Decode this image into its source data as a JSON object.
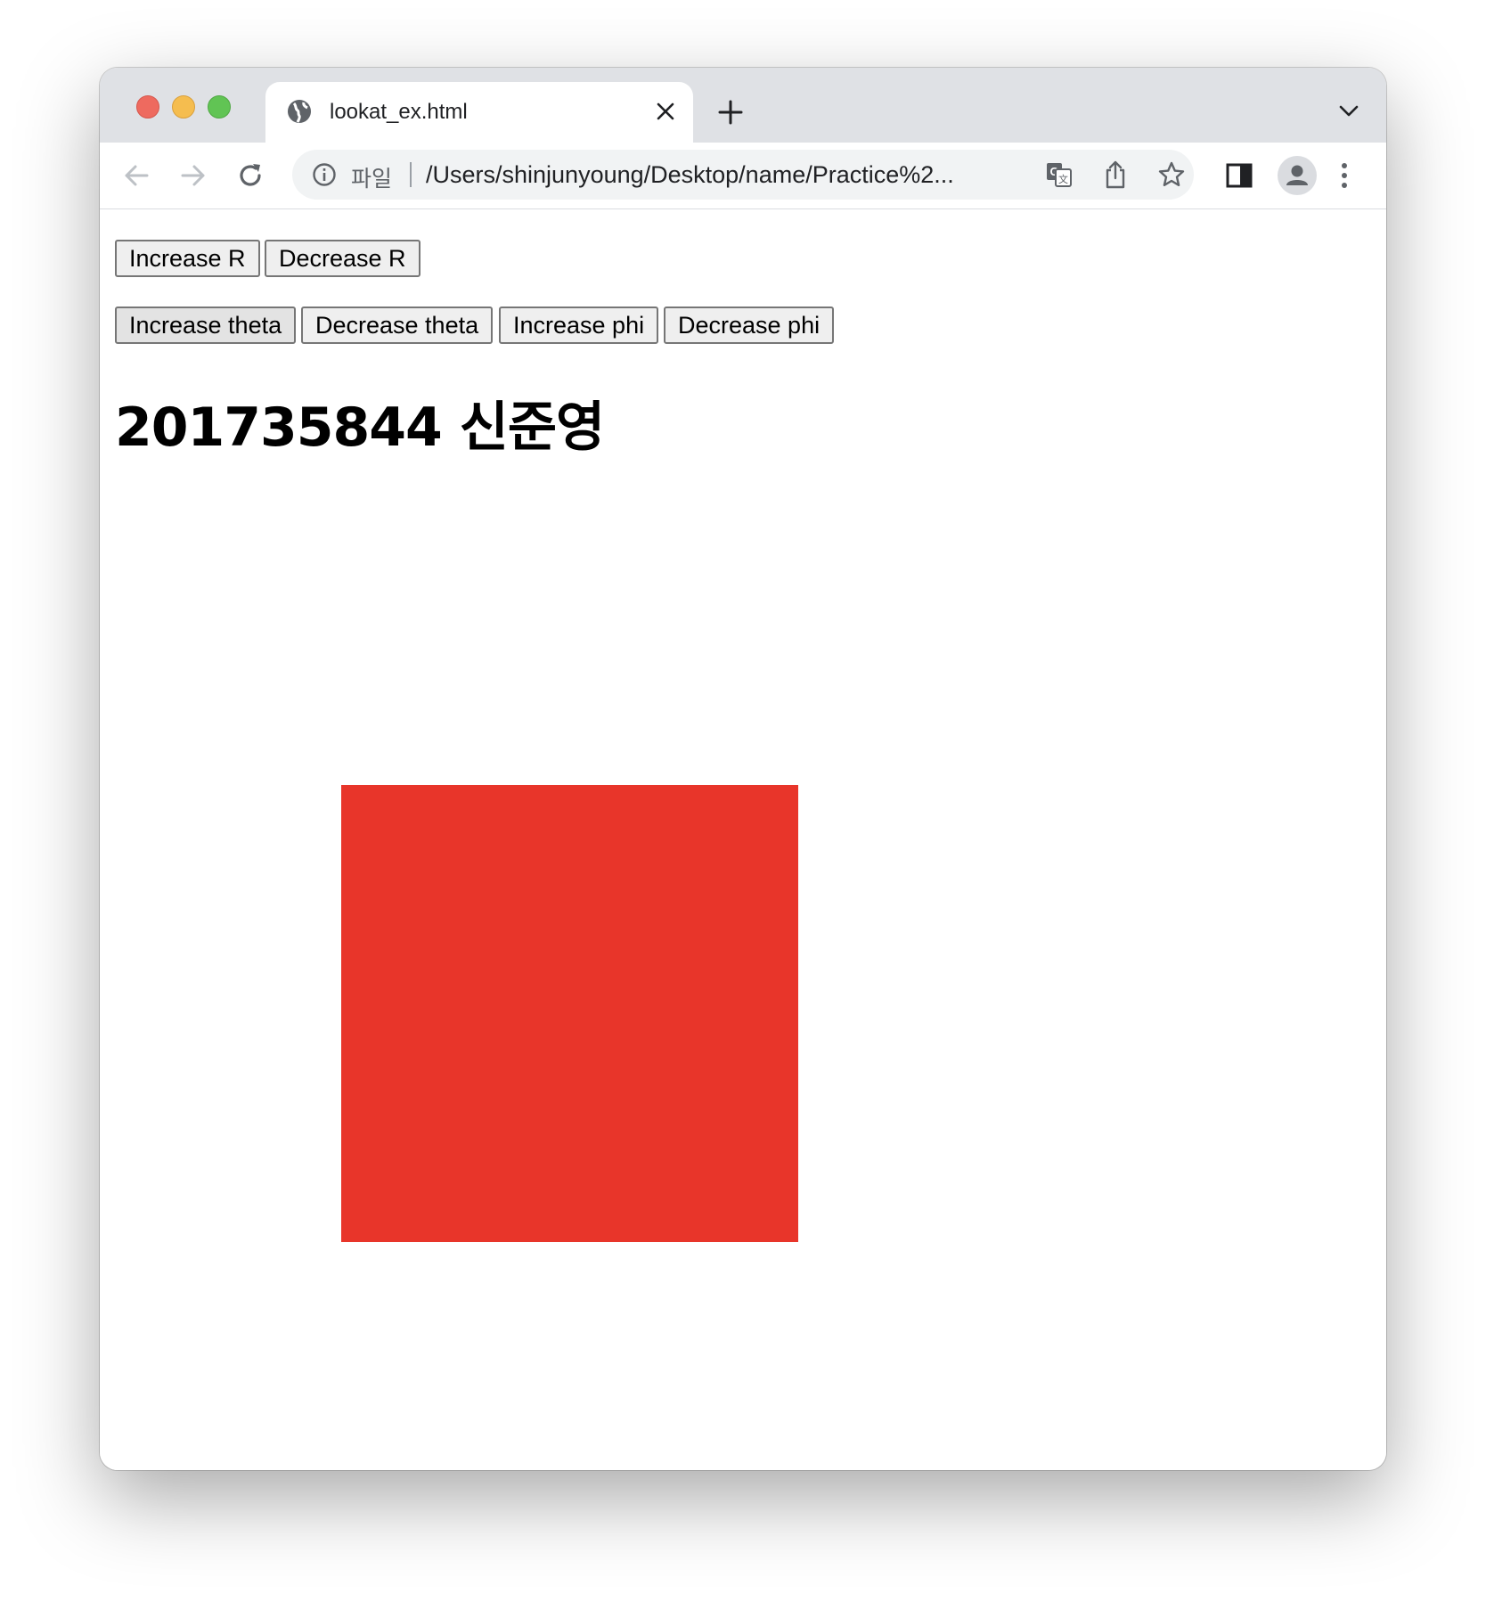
{
  "browser": {
    "tab": {
      "title": "lookat_ex.html"
    },
    "omnibox": {
      "scheme_label": "파일",
      "url": "/Users/shinjunyoung/Desktop/name/Practice%2..."
    }
  },
  "page": {
    "buttons_row1": [
      {
        "label": "Increase R"
      },
      {
        "label": "Decrease R"
      }
    ],
    "buttons_row2": [
      {
        "label": "Increase theta"
      },
      {
        "label": "Decrease theta"
      },
      {
        "label": "Increase phi"
      },
      {
        "label": "Decrease phi"
      }
    ],
    "heading": "201735844 신준영",
    "rendered_square_color": "#e8352a"
  },
  "colors": {
    "traffic_close": "#ee6a5f",
    "traffic_minimize": "#f5bd4f",
    "traffic_maximize": "#61c454",
    "tab_bar": "#dfe1e5",
    "omnibox": "#f1f3f4",
    "button_face": "#efefef"
  },
  "icons": [
    "globe-icon",
    "close-icon",
    "plus-icon",
    "chevron-down-icon",
    "back-arrow-icon",
    "forward-arrow-icon",
    "reload-icon",
    "info-icon",
    "translate-icon",
    "share-icon",
    "star-icon",
    "side-panel-icon",
    "profile-avatar-icon",
    "more-vertical-icon"
  ]
}
